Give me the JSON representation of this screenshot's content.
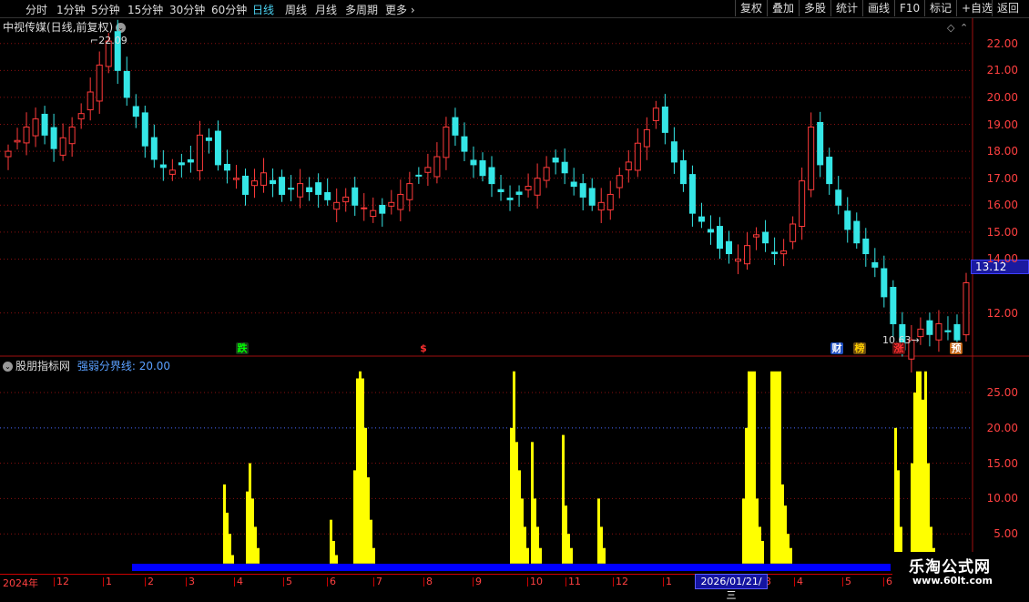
{
  "toolbar": {
    "periods": [
      "分时",
      "1分钟",
      "5分钟",
      "15分钟",
      "30分钟",
      "60分钟",
      "日线",
      "周线",
      "月线",
      "多周期",
      "更多"
    ],
    "active_period": "日线",
    "right_buttons": [
      "复权",
      "叠加",
      "多股",
      "统计",
      "画线",
      "F10",
      "标记",
      "+自选",
      "返回"
    ]
  },
  "main_chart": {
    "title": "中视传媒(日线,前复权)",
    "high_label": "22.09",
    "low_label": "10.63",
    "last_price": "13.12",
    "price_axis": [
      "22.00",
      "21.00",
      "20.00",
      "19.00",
      "18.00",
      "17.00",
      "16.00",
      "15.00",
      "14.00",
      "12.00"
    ],
    "signals": [
      {
        "text": "跌",
        "color": "#00ff00",
        "bg": "#1a3a1a"
      },
      {
        "text": "$",
        "color": "#ff3030",
        "bg": "transparent"
      },
      {
        "text": "财",
        "color": "#fff",
        "bg": "#2050c0"
      },
      {
        "text": "榜",
        "color": "#ffd000",
        "bg": "#6a4a10"
      },
      {
        "text": "涨",
        "color": "#ff3030",
        "bg": "#601010"
      },
      {
        "text": "预",
        "color": "#fff",
        "bg": "#c06010"
      }
    ]
  },
  "indicator": {
    "name": "股朋指标网",
    "line_label": "强弱分界线: 20.00",
    "axis": [
      "25.00",
      "20.00",
      "15.00",
      "10.00",
      "5.00"
    ]
  },
  "date_axis": {
    "labels": [
      "2024年",
      "12",
      "1",
      "2",
      "3",
      "4",
      "5",
      "6",
      "7",
      "8",
      "9",
      "10",
      "11",
      "12",
      "1",
      "2",
      "3",
      "4",
      "5",
      "6"
    ],
    "cursor_date": "2026/01/21/三"
  },
  "watermark": {
    "title": "乐淘公式网",
    "url": "www.60lt.com"
  },
  "colors": {
    "up": "#ff3a3a",
    "down": "#35e6e6",
    "grid": "#8a1010",
    "histogram": "#ffff00",
    "base_bar": "#0000ff",
    "threshold": "#4a6aff"
  },
  "chart_data": {
    "type": "candlestick+histogram",
    "candles_close_approx": [
      18.0,
      18.4,
      18.9,
      19.2,
      18.6,
      18.1,
      18.5,
      18.9,
      19.4,
      20.2,
      21.2,
      22.09,
      21.0,
      20.0,
      19.3,
      18.2,
      17.7,
      17.4,
      17.3,
      17.5,
      17.6,
      18.6,
      18.4,
      17.5,
      17.3,
      17.0,
      16.4,
      16.9,
      17.2,
      16.8,
      16.4,
      16.6,
      16.8,
      16.5,
      16.4,
      16.2,
      16.1,
      16.3,
      16.0,
      15.9,
      15.8,
      15.7,
      16.1,
      16.4,
      16.8,
      17.1,
      17.4,
      17.8,
      18.9,
      18.6,
      18.0,
      17.5,
      17.1,
      16.8,
      16.5,
      16.2,
      16.4,
      16.7,
      17.0,
      17.4,
      17.6,
      17.2,
      16.7,
      16.3,
      16.0,
      16.1,
      16.4,
      17.1,
      17.6,
      18.3,
      18.8,
      19.6,
      18.7,
      17.6,
      16.8,
      15.7,
      15.4,
      15.0,
      14.4,
      14.2,
      14.0,
      14.5,
      14.9,
      14.6,
      14.2,
      14.3,
      15.3,
      16.9,
      18.9,
      17.5,
      16.8,
      16.0,
      15.1,
      14.6,
      14.2,
      13.7,
      12.6,
      11.6,
      10.63,
      11.0,
      11.4,
      11.2,
      11.6,
      11.3,
      11.0,
      13.12
    ],
    "y_range": [
      10.5,
      22.6
    ],
    "indicator_bars": [
      {
        "x": 245,
        "peaks": [
          12,
          8,
          5,
          2
        ]
      },
      {
        "x": 270,
        "peaks": [
          11,
          15,
          10,
          6,
          3
        ]
      },
      {
        "x": 362,
        "peaks": [
          7,
          4,
          2
        ]
      },
      {
        "x": 388,
        "peaks": [
          14,
          27,
          28,
          27,
          20,
          13,
          7,
          3
        ]
      },
      {
        "x": 560,
        "peaks": [
          20,
          28,
          18,
          14,
          10,
          6,
          3
        ]
      },
      {
        "x": 583,
        "peaks": [
          18,
          10,
          6,
          3
        ]
      },
      {
        "x": 617,
        "peaks": [
          19,
          9,
          5,
          3
        ]
      },
      {
        "x": 656,
        "peaks": [
          10,
          6,
          3
        ]
      },
      {
        "x": 815,
        "peaks": [
          10,
          20,
          28,
          28,
          28,
          10,
          6,
          4
        ]
      },
      {
        "x": 846,
        "peaks": [
          28,
          28,
          28,
          28,
          12,
          9,
          5,
          3
        ]
      },
      {
        "x": 982,
        "peaks": [
          20,
          14,
          6
        ]
      },
      {
        "x": 1000,
        "peaks": [
          15,
          25,
          28,
          28,
          24,
          28,
          15,
          6,
          3
        ]
      }
    ],
    "threshold": 20.0,
    "indicator_y_range": [
      0,
      29
    ]
  }
}
